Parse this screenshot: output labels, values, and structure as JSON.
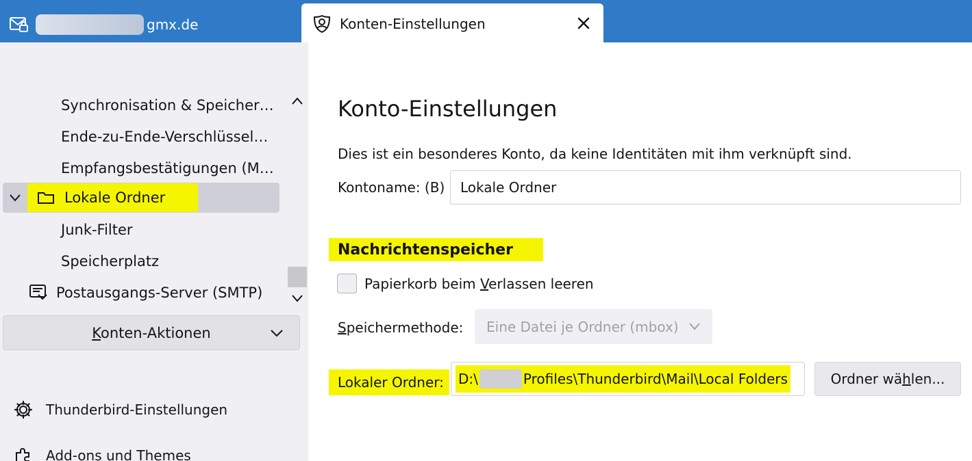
{
  "tabs": {
    "mail_account_suffix": "gmx.de",
    "active_title": "Konten-Einstellungen"
  },
  "sidebar": {
    "items": [
      {
        "label": "Synchronisation & Speicher…"
      },
      {
        "label": "Ende-zu-Ende-Verschlüssel…"
      },
      {
        "label": "Empfangsbestätigungen (M…"
      },
      {
        "label": "Lokale Ordner"
      },
      {
        "label": "Junk-Filter"
      },
      {
        "label": "Speicherplatz"
      },
      {
        "label": "Postausgangs-Server (SMTP)"
      }
    ],
    "actions_pre": "",
    "actions_key": "K",
    "actions_post": "onten-Aktionen",
    "footer": [
      {
        "label": "Thunderbird-Einstellungen"
      },
      {
        "label": "Add-ons und Themes"
      }
    ]
  },
  "main": {
    "title": "Konto-Einstellungen",
    "description": "Dies ist ein besonderes Konto, da keine Identitäten mit ihm verknüpft sind.",
    "account_name_label": "Kontoname: (B)",
    "account_name_value": "Lokale Ordner",
    "section_title": "Nachrichtenspeicher",
    "empty_trash_pre": "Papierkorb beim ",
    "empty_trash_key": "V",
    "empty_trash_post": "erlassen leeren",
    "storage_method_key": "S",
    "storage_method_post": "peichermethode:",
    "storage_method_value": "Eine Datei je Ordner (mbox)",
    "local_folder_label": "Lokaler Ordner:",
    "local_folder_value_start": "D:\\",
    "local_folder_value_end": "Profiles\\Thunderbird\\Mail\\Local Folders",
    "choose_pre": "Ordner wä",
    "choose_key": "h",
    "choose_post": "len..."
  },
  "colors": {
    "accent": "#2f7bc8",
    "highlight": "#f5f500",
    "sidebar_bg": "#f0f0f4",
    "selected_bg": "#cfcfd8"
  },
  "icons": [
    "mail-account-icon",
    "account-settings-icon",
    "close-icon",
    "chevron-up-icon",
    "chevron-down-icon",
    "folder-icon",
    "smtp-server-icon",
    "gear-icon",
    "puzzle-icon"
  ]
}
